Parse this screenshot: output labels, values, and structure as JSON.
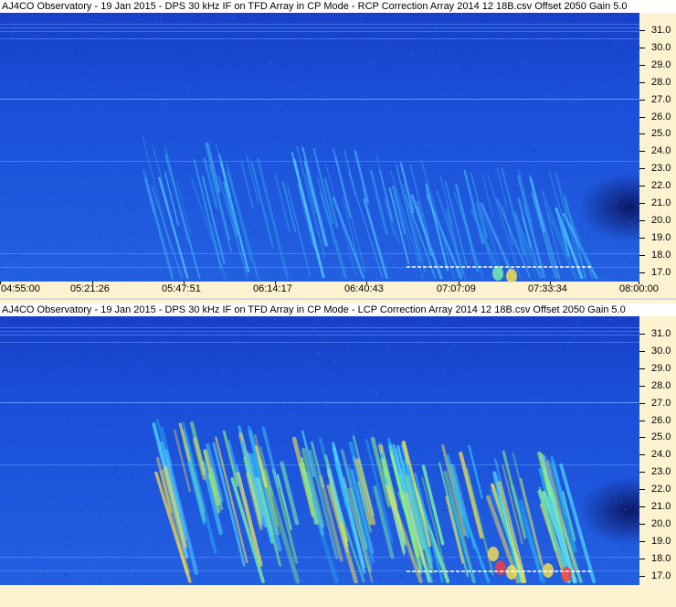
{
  "panels": [
    {
      "title": "AJ4CO Observatory - 19 Jan 2015 - DPS 30 kHz IF on TFD Array in CP Mode - RCP     Correction Array 2014 12 18B.csv     Offset 2050   Gain 5.0",
      "y_ticks": [
        "31.0",
        "30.0",
        "29.0",
        "28.0",
        "27.0",
        "26.0",
        "25.0",
        "24.0",
        "23.0",
        "22.0",
        "21.0",
        "20.0",
        "19.0",
        "18.0",
        "17.0"
      ],
      "x_ticks": [
        "04:55:00",
        "05:21:26",
        "05:47:51",
        "06:14:17",
        "06:40:43",
        "07:07:09",
        "07:33:34",
        "08:00:00"
      ]
    },
    {
      "title": "AJ4CO Observatory - 19 Jan 2015 - DPS 30 kHz IF on TFD Array in CP Mode - LCP     Correction Array 2014 12 18B.csv     Offset 2050   Gain 5.0",
      "y_ticks": [
        "31.0",
        "30.0",
        "29.0",
        "28.0",
        "27.0",
        "26.0",
        "25.0",
        "24.0",
        "23.0",
        "22.0",
        "21.0",
        "20.0",
        "19.0",
        "18.0",
        "17.0"
      ]
    }
  ],
  "colors": {
    "background": "#1a4fd8",
    "dark": "#0b1a7a",
    "burst_low": "#29b6f6",
    "burst_mid": "#7cf0a8",
    "burst_high": "#ffe24a",
    "burst_peak": "#ff3b3b"
  }
}
